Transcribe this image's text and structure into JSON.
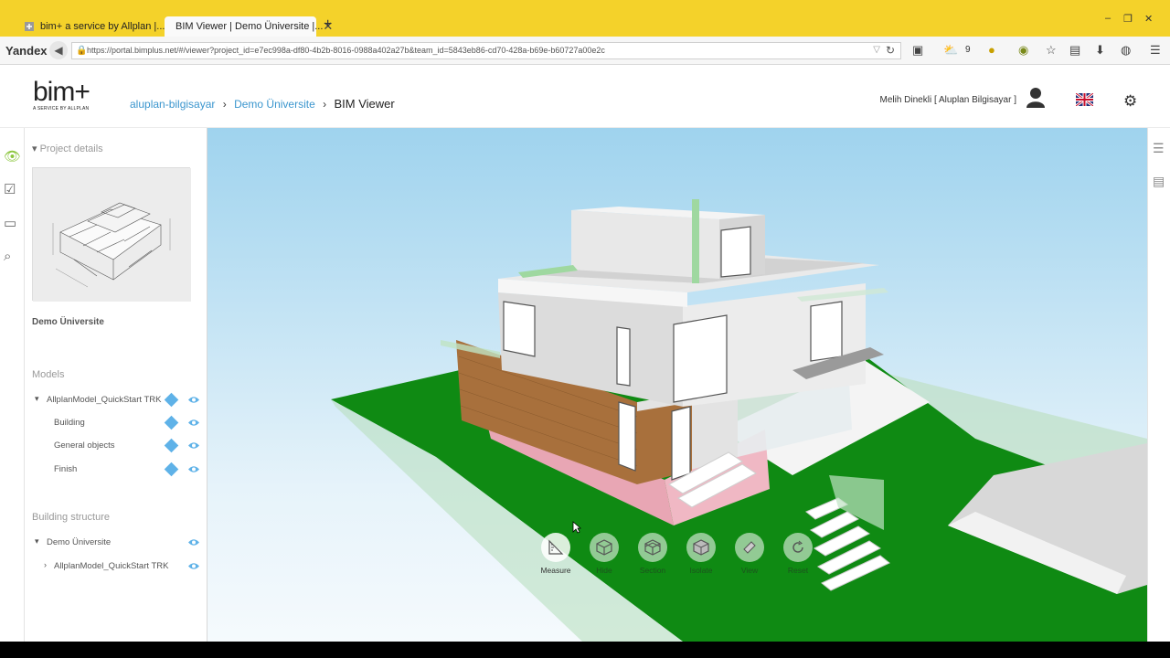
{
  "browser": {
    "tabs": [
      {
        "title": "bim+ a service by Allplan |...",
        "active": false
      },
      {
        "title": "BIM Viewer | Demo Üniversite |...",
        "active": true
      }
    ],
    "brand": "Yandex",
    "url": "https://portal.bimplus.net/#/viewer?project_id=e7ec998a-df80-4b2b-8016-0988a402a27b&team_id=5843eb86-cd70-428a-b69e-b60727a00e2c",
    "badge_count": "9"
  },
  "header": {
    "logo_text": "bim+",
    "logo_tagline": "A SERVICE BY ALLPLAN",
    "breadcrumb": {
      "team": "aluplan-bilgisayar",
      "project": "Demo Üniversite",
      "current": "BIM Viewer"
    },
    "user": "Melih Dinekli [ Aluplan Bilgisayar ]"
  },
  "panel": {
    "project_details": "Project details",
    "project_name": "Demo Üniversite",
    "models_title": "Models",
    "models": [
      {
        "label": "AllplanModel_QuickStart TRK",
        "level": 0
      },
      {
        "label": "Building",
        "level": 1
      },
      {
        "label": "General objects",
        "level": 1
      },
      {
        "label": "Finish",
        "level": 1
      }
    ],
    "structure_title": "Building structure",
    "structure": [
      {
        "label": "Demo Üniversite",
        "level": 0
      },
      {
        "label": "AllplanModel_QuickStart TRK",
        "level": 1
      }
    ]
  },
  "toolbar": {
    "tools": [
      {
        "label": "Measure",
        "icon": "ruler-icon",
        "active": true
      },
      {
        "label": "Hide",
        "icon": "cube-outline-icon",
        "active": false
      },
      {
        "label": "Section",
        "icon": "section-cube-icon",
        "active": false
      },
      {
        "label": "Isolate",
        "icon": "isolate-cube-icon",
        "active": false
      },
      {
        "label": "View",
        "icon": "view-icon",
        "active": false
      },
      {
        "label": "Reset",
        "icon": "reset-icon",
        "active": false
      }
    ]
  },
  "colors": {
    "browser_chrome": "#f4d22a",
    "link": "#3b96ce",
    "grass": "#0f8a13",
    "sky_top": "#9fd3ee",
    "sky_bottom": "#eef7fc",
    "accent_diamond": "#5fb2e8"
  }
}
